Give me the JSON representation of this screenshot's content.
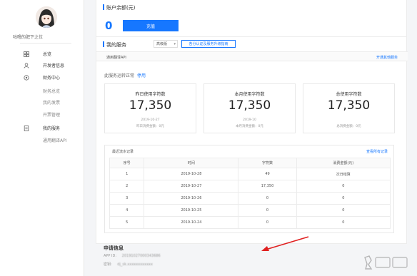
{
  "sidebar": {
    "username": "咕噜的肥下之位",
    "items": [
      {
        "label": "总览",
        "icon": "grid-icon"
      },
      {
        "label": "开发者信息",
        "icon": "user-icon"
      },
      {
        "label": "财务中心",
        "icon": "gear-icon"
      },
      {
        "label": "财务总览",
        "icon": ""
      },
      {
        "label": "我的发票",
        "icon": ""
      },
      {
        "label": "开票管理",
        "icon": ""
      },
      {
        "label": "我的服务",
        "icon": "document-icon"
      },
      {
        "label": "通用翻译API",
        "icon": ""
      }
    ]
  },
  "account": {
    "title": "账户余额(元)",
    "balance": "0",
    "recharge_label": "充值"
  },
  "services": {
    "title": "我的服务",
    "edition_select": "高级版",
    "apply_button": "各分认证及服务升级指南",
    "api_name": "通用翻译API",
    "open_more": "开通其他服务",
    "status_text": "此服务运转正常",
    "stop_label": "停用"
  },
  "stats": [
    {
      "title": "昨日使用字符数",
      "value": "17,350",
      "date": "2019-10-27",
      "note": "昨日消费金额：0元"
    },
    {
      "title": "本月使用字符数",
      "value": "17,350",
      "date": "2019-10",
      "note": "本月消费金额：0元"
    },
    {
      "title": "总使用字符数",
      "value": "17,350",
      "date": "",
      "note": "总消费金额：0元"
    }
  ],
  "records": {
    "title": "最近流水记录",
    "view_all": "查看所有记录",
    "columns": [
      "序号",
      "时间",
      "字符数",
      "消费金额(元)"
    ],
    "rows": [
      [
        "1",
        "2019-10-28",
        "49",
        "次日结算"
      ],
      [
        "2",
        "2019-10-27",
        "17,350",
        "0"
      ],
      [
        "3",
        "2019-10-26",
        "0",
        "0"
      ],
      [
        "4",
        "2019-10-25",
        "0",
        "0"
      ],
      [
        "5",
        "2019-10-24",
        "0",
        "0"
      ]
    ]
  },
  "apply": {
    "title": "申请信息",
    "app_id_label": "APP ID:",
    "app_id_value": "20191027000343686",
    "key_label": "密钥:",
    "key_value": "dj_sk.xxxxxxxxxxxx"
  },
  "colors": {
    "accent": "#1677ff"
  }
}
